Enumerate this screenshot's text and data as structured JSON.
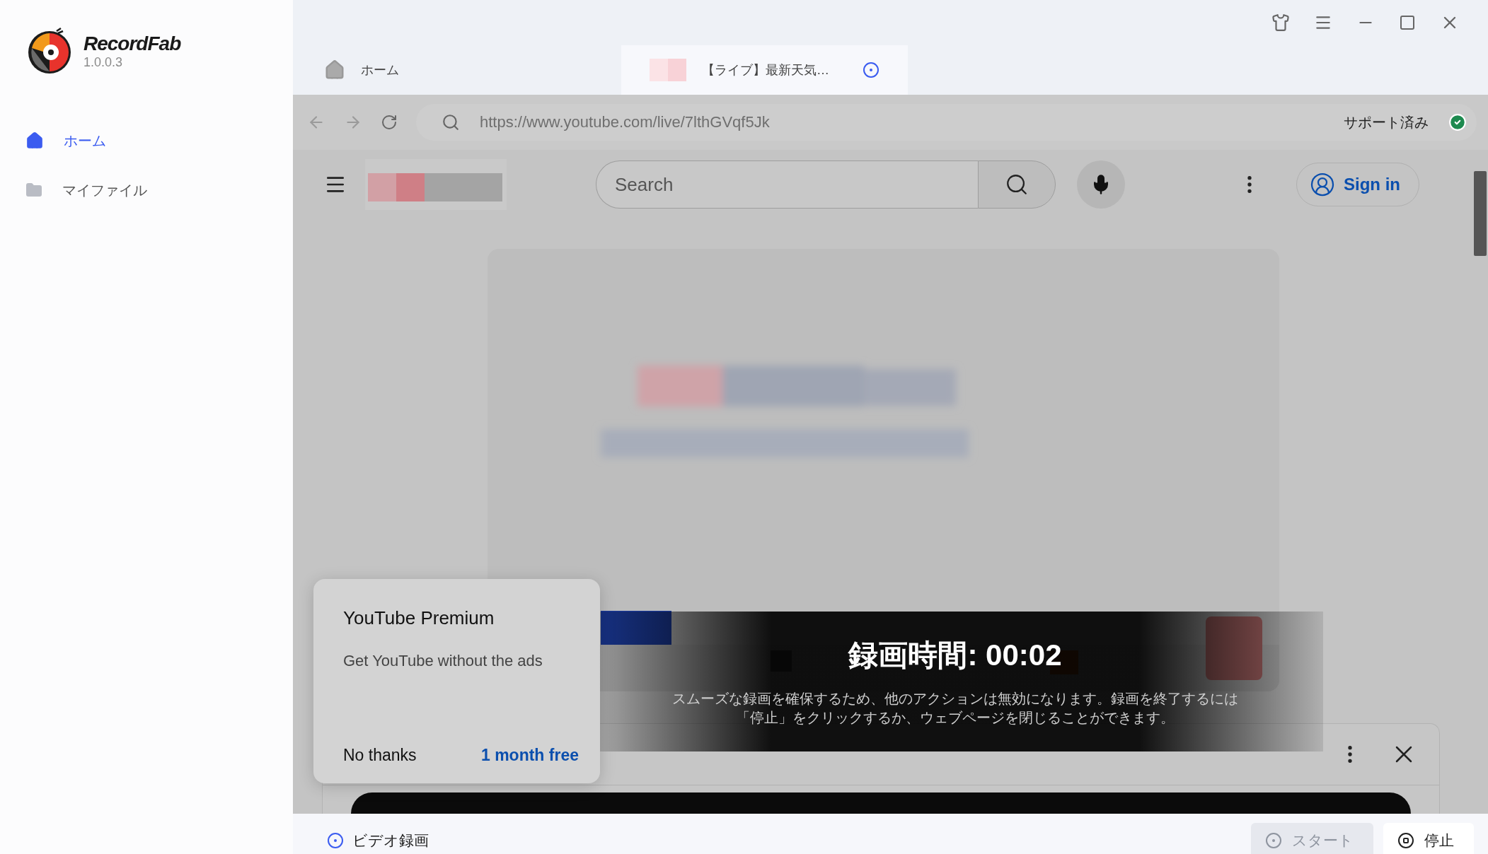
{
  "app": {
    "name": "RecordFab",
    "version": "1.0.0.3"
  },
  "sidebar": {
    "items": [
      {
        "label": "ホーム",
        "selected": true,
        "kind": "home"
      },
      {
        "label": "マイファイル",
        "selected": false,
        "kind": "folder"
      }
    ]
  },
  "tabs": [
    {
      "label": "ホーム",
      "selected": false,
      "kind": "home"
    },
    {
      "label": "【ライブ】最新天気…",
      "selected": true,
      "kind": "page"
    }
  ],
  "address_bar": {
    "url": "https://www.youtube.com/live/7lthGVqf5Jk",
    "status": "サポート済み"
  },
  "youtube": {
    "search": {
      "placeholder": "Search"
    },
    "sign_in": "Sign in"
  },
  "recording_overlay": {
    "timer": "録画時間: 00:02",
    "message": "スムーズな録画を確保するため、他のアクションは無効になります。録画を終了するには「停止」をクリックするか、ウェブページを閉じることができます。"
  },
  "premium_popup": {
    "title": "YouTube Premium",
    "text": "Get YouTube without the ads",
    "buttons": [
      {
        "label": "No thanks",
        "kind": "plain"
      },
      {
        "label": "1 month free",
        "kind": "link"
      }
    ]
  },
  "bottom_bar": {
    "mode": {
      "label": "ビデオ録画",
      "selected": true
    },
    "buttons": [
      {
        "label": "スタート",
        "disabled": true,
        "kind": "start"
      },
      {
        "label": "停止",
        "disabled": false,
        "kind": "stop"
      }
    ]
  }
}
